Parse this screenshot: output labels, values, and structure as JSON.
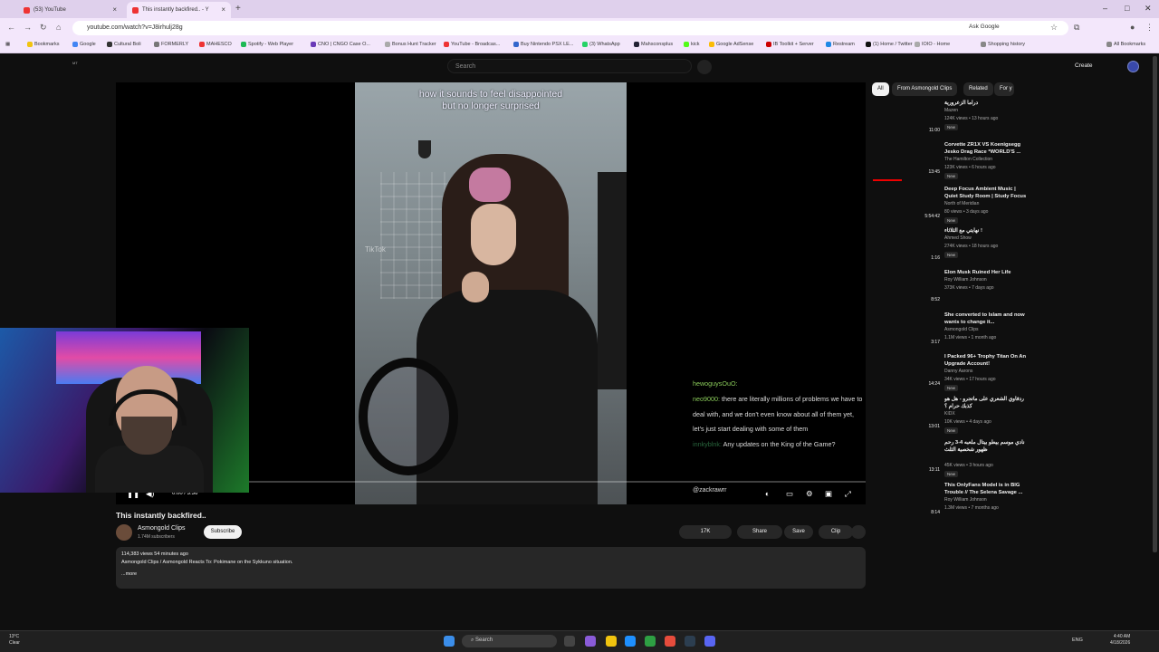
{
  "browser": {
    "tabs": [
      {
        "label": "(53) YouTube"
      },
      {
        "label": "This instantly backfired.. - Y"
      }
    ],
    "url": "youtube.com/watch?v=J8irhulj28g",
    "ask_google": "Ask Google",
    "bookmarks": [
      "Bookmarks",
      "Google",
      "Cultural Boli",
      "FORMERLY",
      "MAHESCO",
      "Spotify - Web Player",
      "CNO | CNGO Case O...",
      "Bonus Hunt Tracker",
      "YouTube - Broadcas...",
      "Buy Nintendo PSX LE...",
      "(3) WhatsApp",
      "Mahsconsplus",
      "kick",
      "Google AdSense",
      "IB Toolkit + Server",
      "Restream",
      "(1) Home / Twitter",
      "IOIO - Home",
      "Shopping history"
    ],
    "all_bookmarks": "All Bookmarks"
  },
  "youtube": {
    "logo_small": "MT",
    "search_placeholder": "Search",
    "create": "Create"
  },
  "player": {
    "caption_line1": "how it sounds to feel disappointed",
    "caption_line2": "but no longer surprised",
    "tiktok_mark": "TikTok",
    "chat": [
      {
        "user": "hewoguysOuO:",
        "text": ""
      },
      {
        "user": "neo9000:",
        "text": "there are literally millions of problems we have to deal with, and we don't even know about all of them yet, let's just start dealing with some of them"
      },
      {
        "user": "innkyblnk:",
        "text": "Any updates on the King of the Game?"
      }
    ],
    "handle": "@zackrawrr",
    "time": "0:00 / 3:36"
  },
  "video": {
    "title": "This instantly backfired..",
    "channel": "Asmongold Clips",
    "subscribers": "1.74M subscribers",
    "subscribe": "Subscribe",
    "likes": "17K",
    "share": "Share",
    "save": "Save",
    "clip": "Clip",
    "views_time": "114,383 views  54 minutes ago",
    "description": "Asmongold Clips / Asmongold Reacts To: Pokimane on the Sykkuno situation.",
    "more": "...more"
  },
  "sidebar": {
    "chips": [
      "All",
      "From Asmongold Clips",
      "Related",
      "For y"
    ],
    "items": [
      {
        "title": "دراما الزعرورية",
        "channel": "Mazen",
        "meta": "124K views • 13 hours ago",
        "badge": "New",
        "duration": "11:00"
      },
      {
        "title": "Corvette ZR1X VS Koenigsegg Jesko Drag Race *WORLD'S ...",
        "channel": "The Hamilton Collection",
        "meta": "123K views • 6 hours ago",
        "badge": "New",
        "duration": "13:45"
      },
      {
        "title": "Deep Focus Ambient Music | Quiet Study Room | Study Focus",
        "channel": "North of Meridian",
        "meta": "80 views • 3 days ago",
        "badge": "New",
        "duration": "5:54:42"
      },
      {
        "title": "نهايتي مع الثلاثاء !",
        "channel": "Ahmed Show",
        "meta": "274K views • 18 hours ago",
        "badge": "New",
        "duration": "1:16"
      },
      {
        "title": "Elon Musk Ruined Her Life",
        "channel": "Roy William Johnson",
        "meta": "373K views • 7 days ago",
        "badge": "",
        "duration": "8:52"
      },
      {
        "title": "She converted to Islam and now wants to change it...",
        "channel": "Asmongold Clips",
        "meta": "1.1M views • 1 month ago",
        "badge": "",
        "duration": "3:17"
      },
      {
        "title": "I Packed 96+ Trophy Titan On An Upgrade Account!",
        "channel": "Danny Aarons",
        "meta": "34K views • 17 hours ago",
        "badge": "New",
        "duration": "14:24"
      },
      {
        "title": "ردفاوي الشعري على ماتجرو - هل هو كذبك حرام ؟",
        "channel": "KIDX",
        "meta": "10K views • 4 days ago",
        "badge": "New",
        "duration": "13:01"
      },
      {
        "title": "نادي موسم بيطو بيتال ملعبه 4-3 رحم ظهور شخصية الثلث",
        "channel": "",
        "meta": "45K views • 3 hours ago",
        "badge": "New",
        "duration": "13:11"
      },
      {
        "title": "This OnlyFans Model is in BIG Trouble // The Selena Savage ...",
        "channel": "Roy William Johnson",
        "meta": "1.3M views • 7 months ago",
        "badge": "",
        "duration": "8:14"
      }
    ]
  },
  "taskbar": {
    "temp": "13°C",
    "weather": "Clear",
    "search": "Search",
    "lang": "ENG",
    "time": "4:40 AM",
    "date": "4/18/2026"
  }
}
